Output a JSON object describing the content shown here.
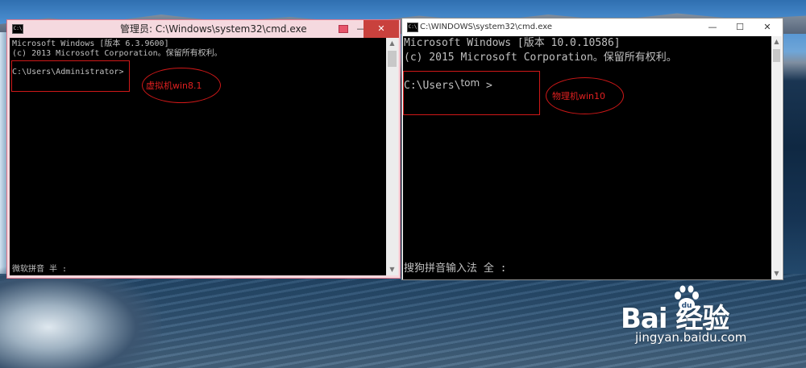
{
  "left_window": {
    "title": "管理员: C:\\Windows\\system32\\cmd.exe",
    "icon": "cmd-icon",
    "lines": [
      "Microsoft Windows [版本 6.3.9600]",
      "(c) 2013 Microsoft Corporation。保留所有权利。",
      "",
      "C:\\Users\\Administrator>"
    ],
    "ime_status": "微软拼音 半 :",
    "annotation": "虚拟机win8.1"
  },
  "right_window": {
    "title": "C:\\WINDOWS\\system32\\cmd.exe",
    "icon": "cmd-icon",
    "lines": [
      "Microsoft Windows [版本 10.0.10586]",
      "(c) 2015 Microsoft Corporation。保留所有权利。",
      "",
      "C:\\Users\\"
    ],
    "user_text": "tom",
    "prompt_tail": " >",
    "ime_status": "搜狗拼音输入法 全 :",
    "annotation": "物理机win10"
  },
  "controls": {
    "minimize": "—",
    "maximize": "☐",
    "close": "✕"
  },
  "watermark": {
    "logo_text": "Bai  经验",
    "url": "jingyan.baidu.com"
  },
  "colors": {
    "console_text": "#c0c0c0",
    "annotation_red": "#e02020",
    "left_titlebar": "#f5d9df"
  }
}
